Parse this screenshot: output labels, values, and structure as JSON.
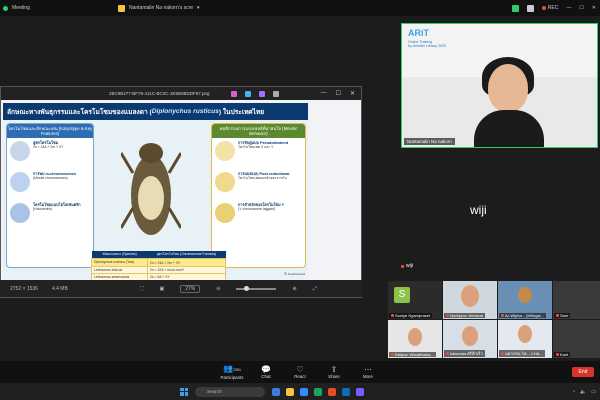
{
  "topbar": {
    "meeting_label": "Meeting",
    "tab_title": "Nantamalin Na nakorn's scre",
    "rec_label": "REC"
  },
  "shared_window": {
    "filename": "2BC9B477-BF79-411C-BC0C-3E5B0BDDF87.png",
    "dimensions": "2752 × 1536",
    "file_size": "4.4 MB",
    "zoom": "27%"
  },
  "slide": {
    "title_prefix": "ลักษณะทางพันธุกรรมและโครโมโซมของแมลงดา (",
    "title_species": "Diplonychus rusticus",
    "title_suffix": ") ในประเทศไทย",
    "left_header": "โครโมโซมและลักษณะเด่น (Karyotype & Key Features)",
    "right_header": "พฤติกรรมการแบ่งเซลล์ที่น่าสนใจ (Meiotic Behavior)",
    "left_items": [
      {
        "title": "สูตรโครโมโซม",
        "text": "2n = 24A + 2m + XY"
      },
      {
        "title": "การพบ m-chromosomes",
        "text": "(Minute chromosomes)"
      },
      {
        "title": "โครโมโซมแบบโฮโลเซนตริก",
        "text": "(Holocentric)"
      }
    ],
    "right_items": [
      {
        "title": "การจับคู่แบบ Pseudobivalent",
        "text": "โครโมโซมเพศ X และ Y"
      },
      {
        "title": "การแบ่งแบบ Post-reductional",
        "text": "โครโมโซมเพศแยกตัวออกจากกัน"
      },
      {
        "title": "การล้าหลังของโครโมโซม Y",
        "text": "(Y chromosome laggard)"
      }
    ],
    "table_headers": [
      "ชนิดแมลงดา (Species)",
      "สูตรโครโมโซม (Chromosome Formula)"
    ],
    "table_rows": [
      [
        "Diplonychus rusticus (ไทย)",
        "2n = 24A + 2m + XY"
      ],
      [
        "Lethocerus indicus",
        "2n = 22A + neoX-neoY"
      ],
      [
        "Lethocerus americanus",
        "2n = 6A + XY"
      ]
    ],
    "credit": "ที่: NotebookLM"
  },
  "speaker": {
    "brand": "ARiT",
    "brand_sub_1": "Online Training",
    "brand_sub_2": "by Arrestin Library 2020",
    "name": "Nantamalin Na nakorn"
  },
  "wiji": {
    "large_name": "wiji",
    "small_name": "wiji"
  },
  "participants": [
    {
      "name": "Somjai Ngampraset",
      "avatar_letter": "S"
    },
    {
      "name": "Nuchjaon Jireewat"
    },
    {
      "name": "Ar-Wipha... (iWingst..."
    },
    {
      "name": "Sare"
    },
    {
      "name": "Kittipun Wiwatthaba..."
    },
    {
      "name": "kakamas ศรีฟ้าเร็ว"
    },
    {
      "name": "นพวรรณ ไท... CHA..."
    },
    {
      "name": "Kant"
    }
  ],
  "toolbar": {
    "participants_count": "2391",
    "participants_label": "Participants",
    "chat_label": "Chat",
    "react_label": "React",
    "share_label": "Share",
    "more_label": "More",
    "end_label": "End"
  },
  "taskbar": {
    "search_placeholder": "Search"
  }
}
